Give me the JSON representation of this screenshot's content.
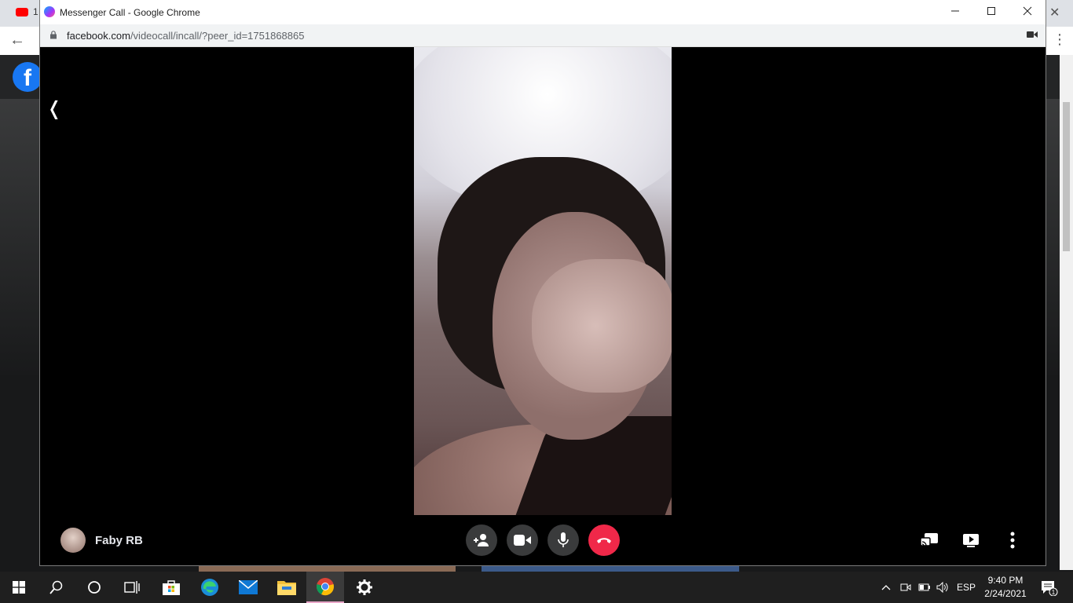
{
  "background_browser": {
    "tab_fragment": "1"
  },
  "popup": {
    "window_title": "Messenger Call - Google Chrome",
    "url_domain": "facebook.com",
    "url_path": "/videocall/incall/?peer_id=1751868865"
  },
  "call": {
    "back_chevron": "❬",
    "caller_name": "Faby RB",
    "controls": [
      {
        "icon": "add-person-icon"
      },
      {
        "icon": "video-camera-icon"
      },
      {
        "icon": "microphone-icon"
      },
      {
        "icon": "end-call-icon",
        "color": "#f02849"
      }
    ],
    "right_controls": [
      {
        "icon": "cast-icon"
      },
      {
        "icon": "screen-share-icon"
      },
      {
        "icon": "more-options-icon"
      }
    ]
  },
  "taskbar": {
    "language": "ESP",
    "time": "9:40 PM",
    "date": "2/24/2021",
    "notification_count": "1",
    "active_app": "chrome-icon"
  }
}
